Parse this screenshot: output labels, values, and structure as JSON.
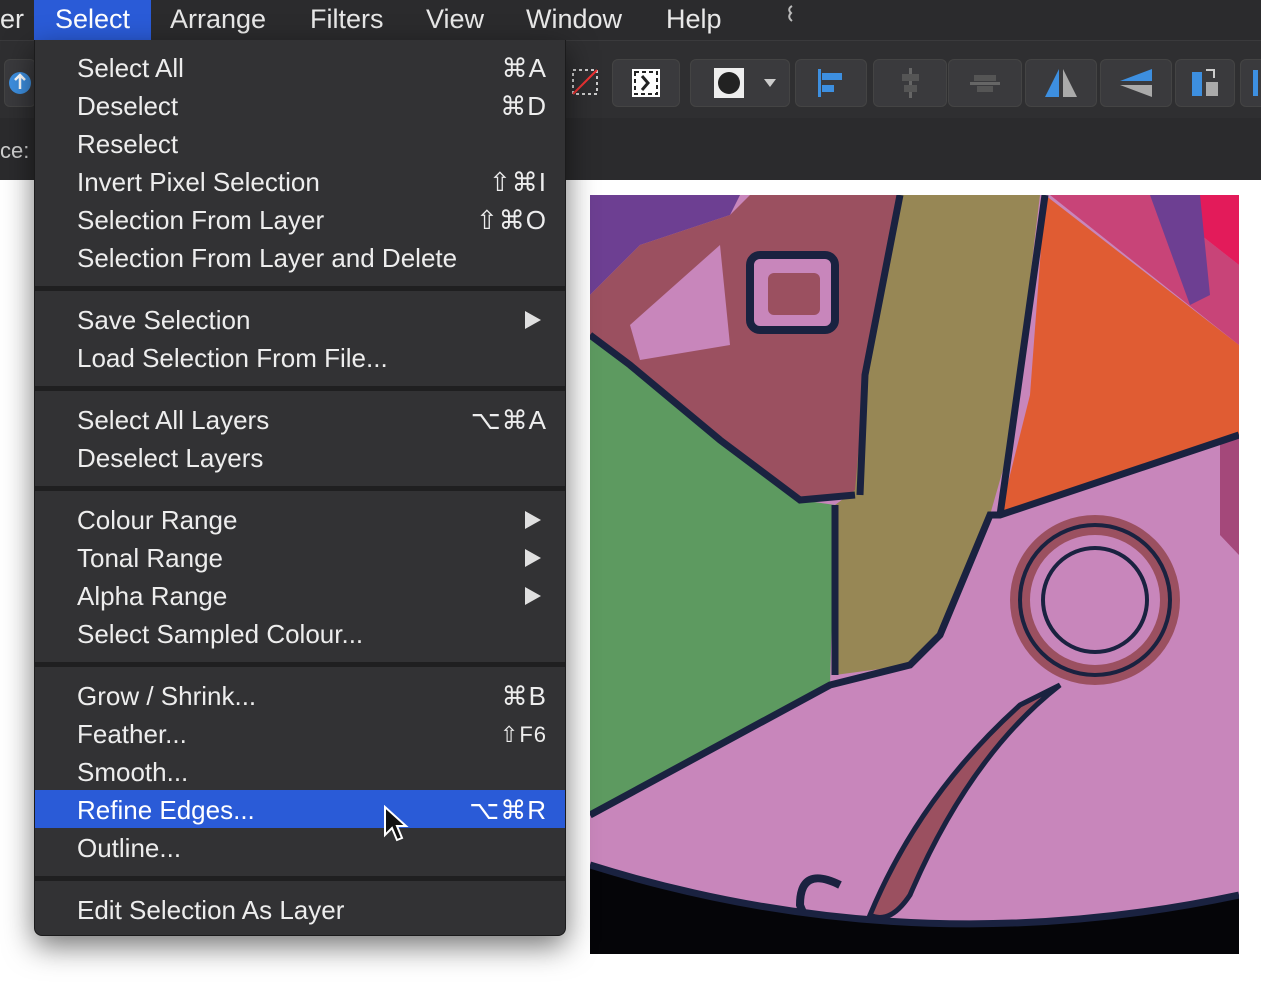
{
  "menubar": {
    "items": [
      {
        "label": "er",
        "active": false
      },
      {
        "label": "Select",
        "active": true
      },
      {
        "label": "Arrange",
        "active": false
      },
      {
        "label": "Filters",
        "active": false
      },
      {
        "label": "View",
        "active": false
      },
      {
        "label": "Window",
        "active": false
      },
      {
        "label": "Help",
        "active": false
      }
    ]
  },
  "contextbar": {
    "label": "ce:"
  },
  "menu": {
    "items": [
      {
        "label": "Select All",
        "shortcut": "⌘A"
      },
      {
        "label": "Deselect",
        "shortcut": "⌘D"
      },
      {
        "label": "Reselect",
        "shortcut": ""
      },
      {
        "label": "Invert Pixel Selection",
        "shortcut": "⇧⌘I"
      },
      {
        "label": "Selection From Layer",
        "shortcut": "⇧⌘O"
      },
      {
        "label": "Selection From Layer and Delete",
        "shortcut": ""
      },
      {
        "label": "Save Selection",
        "shortcut": "",
        "submenu": true
      },
      {
        "label": "Load Selection From File...",
        "shortcut": ""
      },
      {
        "label": "Select All Layers",
        "shortcut": "⌥⌘A"
      },
      {
        "label": "Deselect Layers",
        "shortcut": ""
      },
      {
        "label": "Colour Range",
        "shortcut": "",
        "submenu": true
      },
      {
        "label": "Tonal Range",
        "shortcut": "",
        "submenu": true
      },
      {
        "label": "Alpha Range",
        "shortcut": "",
        "submenu": true
      },
      {
        "label": "Select Sampled Colour...",
        "shortcut": ""
      },
      {
        "label": "Grow / Shrink...",
        "shortcut": "⌘B"
      },
      {
        "label": "Feather...",
        "shortcut": "⇧F6"
      },
      {
        "label": "Smooth...",
        "shortcut": ""
      },
      {
        "label": "Refine Edges...",
        "shortcut": "⌥⌘R",
        "highlighted": true
      },
      {
        "label": "Outline...",
        "shortcut": ""
      },
      {
        "label": "Edit Selection As Layer",
        "shortcut": ""
      }
    ]
  },
  "colors": {
    "accent": "#2a5bd7",
    "menu_bg": "#323234",
    "toolbar_bg": "#2f2f31"
  }
}
